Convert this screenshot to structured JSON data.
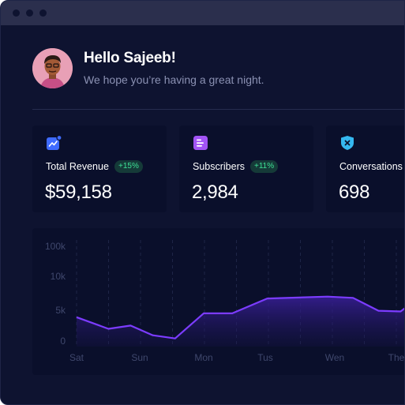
{
  "header": {
    "greeting": "Hello Sajeeb!",
    "subtitle": "We hope you’re having a great night."
  },
  "cards": [
    {
      "label": "Total Revenue",
      "badge": "+15%",
      "value": "$59,158",
      "icon": "trending-chart-icon",
      "accent": "#3f6bff"
    },
    {
      "label": "Subscribers",
      "badge": "+11%",
      "value": "2,984",
      "icon": "document-list-icon",
      "accent": "#a254f5"
    },
    {
      "label": "Conversations",
      "badge": "",
      "value": "698",
      "icon": "shield-x-icon",
      "accent": "#35b8f0"
    }
  ],
  "chart_data": {
    "type": "area",
    "x": [
      "Sat",
      "",
      "Sun",
      "",
      "",
      "",
      "Mon",
      "",
      "",
      "Tus",
      "",
      "",
      "Wen",
      "",
      "",
      "The"
    ],
    "y_ticks": [
      "100k",
      "10k",
      "5k",
      "0"
    ],
    "y": [
      3.7,
      1.9,
      2.4,
      0.9,
      0.4,
      4.3,
      4.3,
      6.6,
      6.9,
      6.7,
      4.7,
      4.6,
      6.9
    ],
    "series_x": [
      0,
      0.5,
      0.85,
      1.2,
      1.55,
      2.0,
      2.45,
      3.0,
      3.95,
      4.35,
      4.75,
      5.1,
      5.4
    ],
    "x_labels": [
      "Sat",
      "Sun",
      "Mon",
      "Tus",
      "Wen",
      "The"
    ],
    "line_color": "#7c3cff",
    "fill_color": "#2a1a6e",
    "grid": "dashed vertical"
  }
}
